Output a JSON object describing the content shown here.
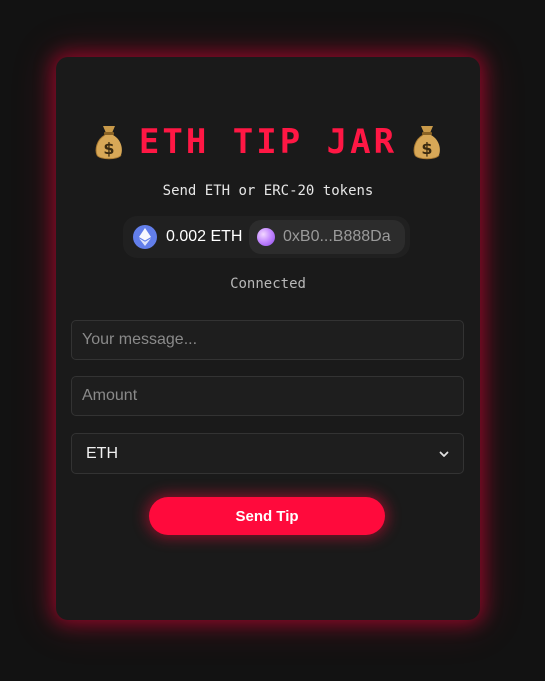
{
  "app": {
    "title": "ETH TIP JAR",
    "subtitle": "Send ETH or ERC-20 tokens",
    "status": "Connected"
  },
  "wallet": {
    "balance": "0.002 ETH",
    "address": "0xB0...B888Da",
    "balance_icon": "eth-icon",
    "account_icon": "avatar-icon"
  },
  "form": {
    "message_placeholder": "Your message...",
    "amount_placeholder": "Amount",
    "token_selected": "ETH",
    "submit_label": "Send Tip"
  },
  "icons": {
    "title_decoration": "money-bag-icon",
    "select_arrow": "chevron-down-icon"
  },
  "colors": {
    "accent": "#ff1744",
    "button": "#ff0a3c",
    "background": "#121212",
    "card": "#1a1a1a",
    "eth": "#627eea"
  }
}
